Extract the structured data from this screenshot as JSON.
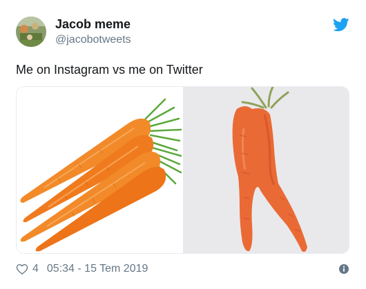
{
  "user": {
    "display_name": "Jacob meme",
    "handle": "@jacobotweets",
    "avatar_icon": "avatar-image"
  },
  "tweet": {
    "text": "Me on Instagram vs me on Twitter",
    "images": [
      {
        "icon": "carrots-image"
      },
      {
        "icon": "forked-carrot-image"
      }
    ]
  },
  "footer": {
    "like_count": "4",
    "timestamp": "05:34 - 15 Tem 2019",
    "like_icon": "heart-icon",
    "info_icon": "info-icon"
  },
  "colors": {
    "twitter_blue": "#1da1f2",
    "text_primary": "#14171a",
    "text_secondary": "#657786",
    "carrot_orange": "#f07b1e"
  }
}
